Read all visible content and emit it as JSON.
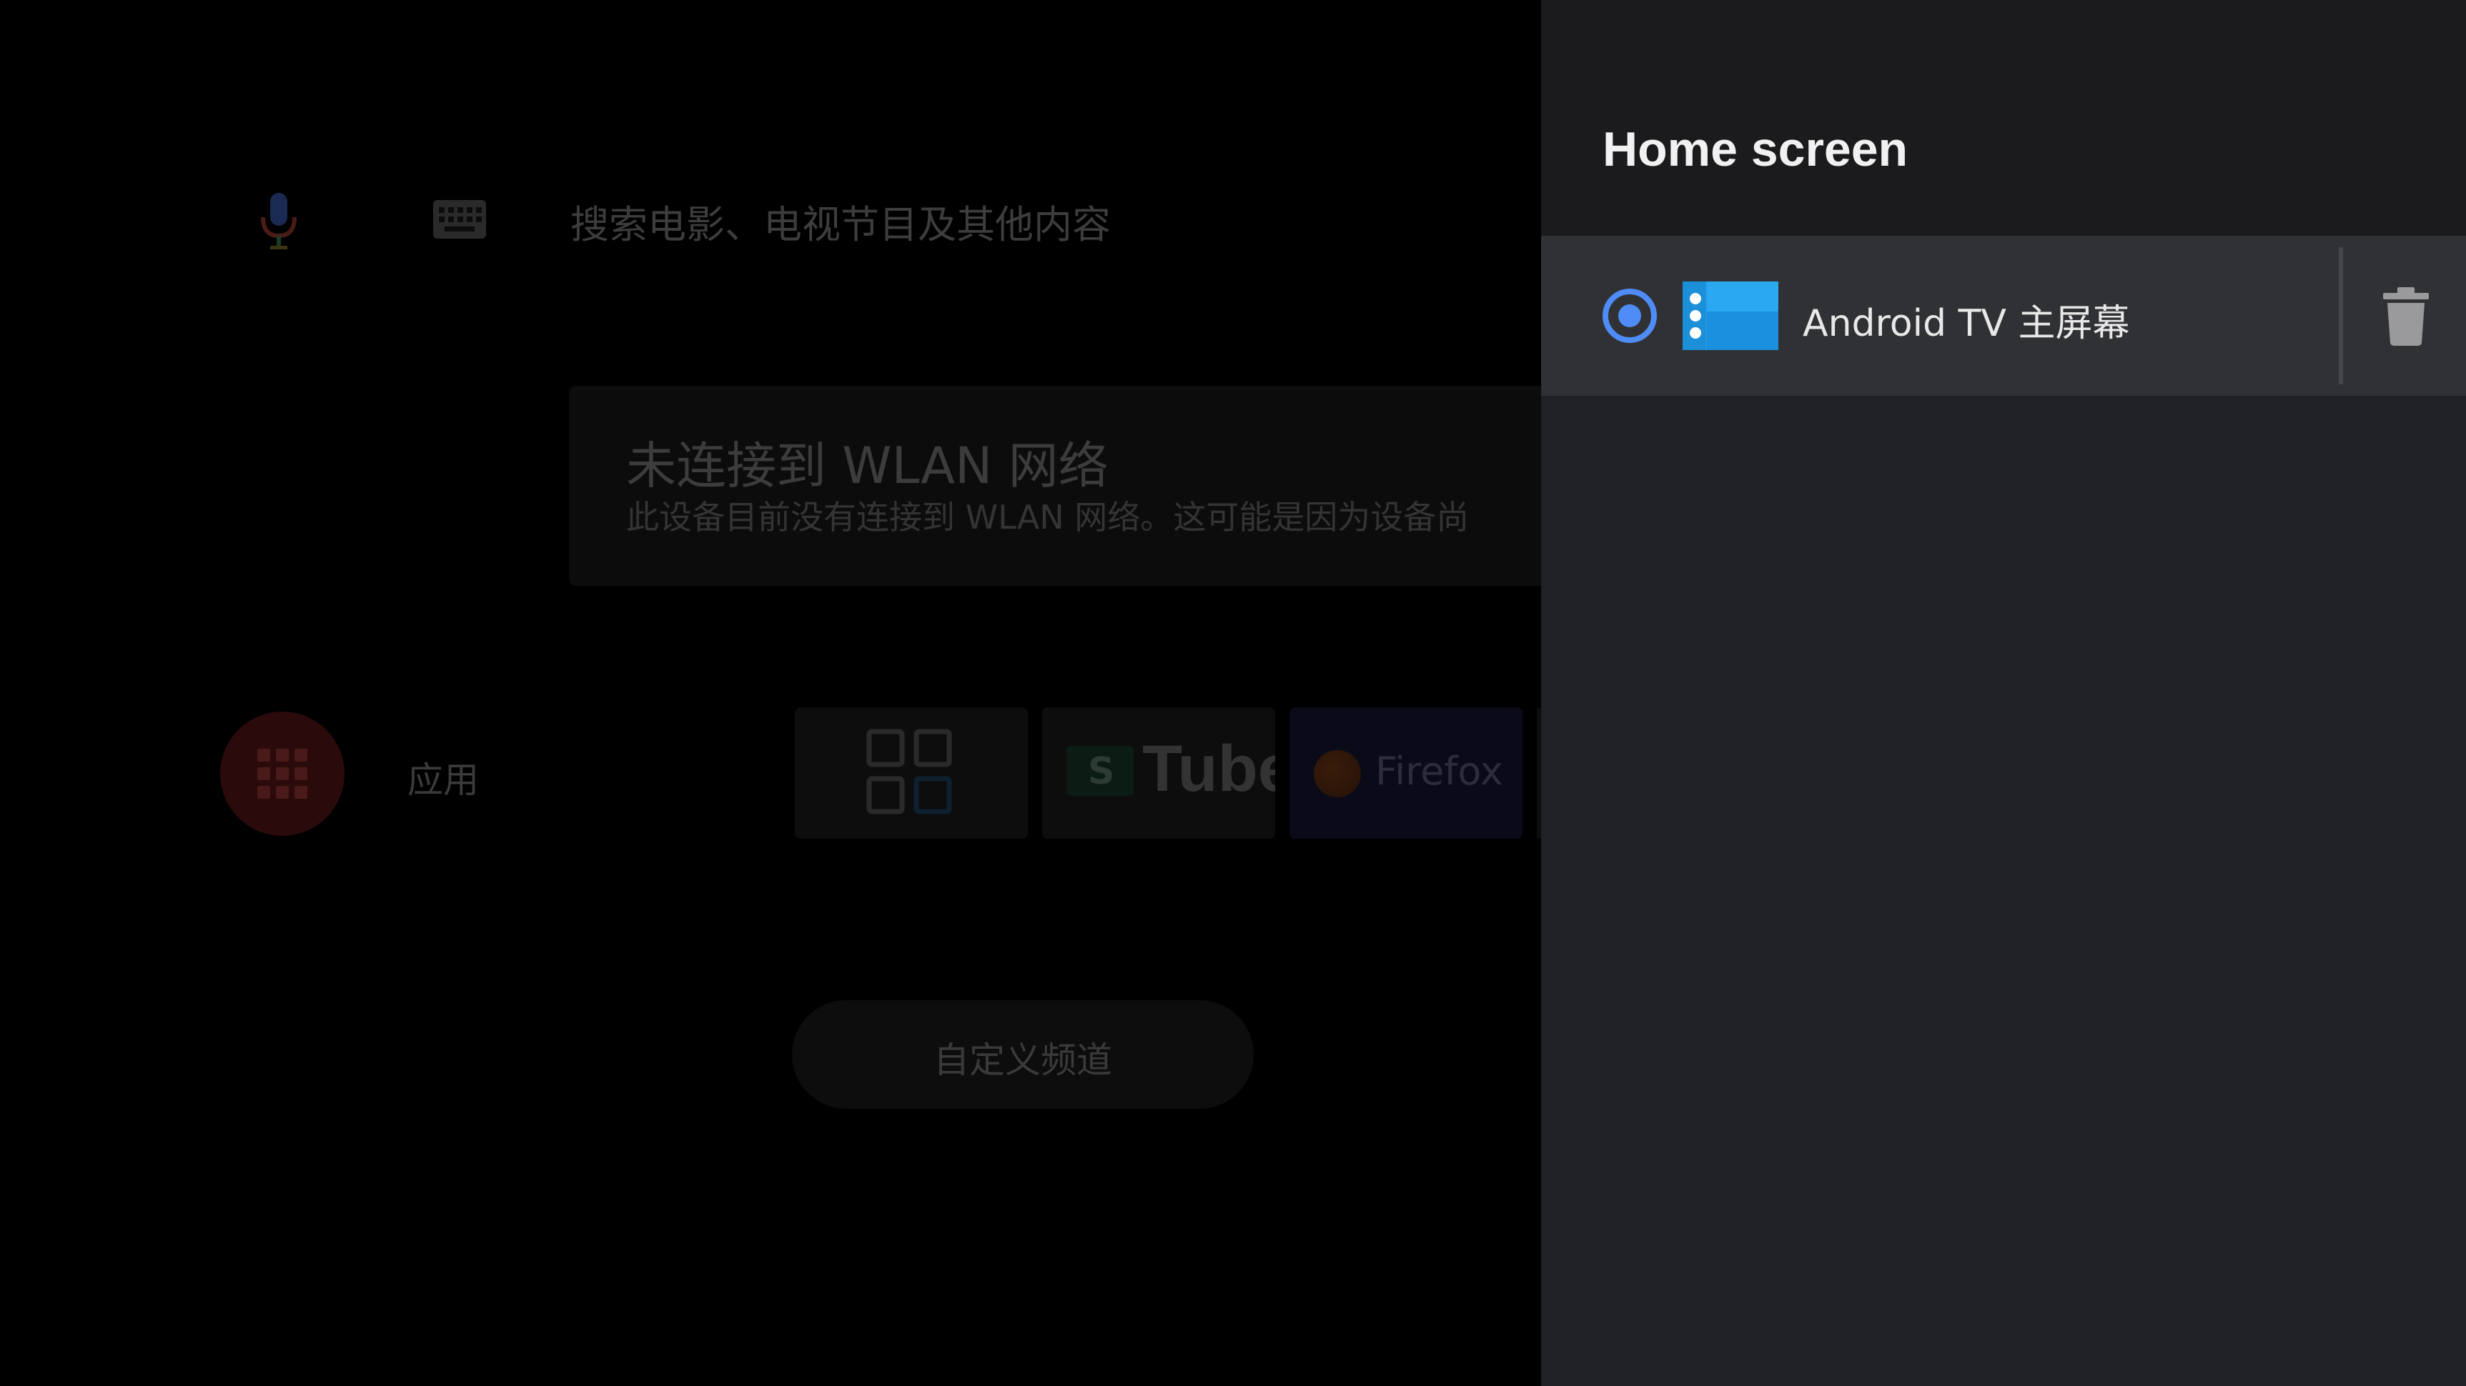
{
  "search": {
    "placeholder_text": "搜索电影、电视节目及其他内容",
    "mic_icon": "microphone-icon",
    "keyboard_icon": "keyboard-icon"
  },
  "notification": {
    "title": "未连接到 WLAN 网络",
    "description": "此设备目前没有连接到 WLAN 网络。这可能是因为设备尚"
  },
  "apps_row": {
    "label": "应用",
    "icon": "apps-grid-icon",
    "tiles": [
      {
        "name": "app-grid-tile",
        "icon": "grid-squares-icon"
      },
      {
        "name": "youtube-tile",
        "text": "Tube",
        "badge": "S"
      },
      {
        "name": "firefox-tile",
        "text": "Firefox"
      }
    ]
  },
  "customize_channels": {
    "label": "自定义频道"
  },
  "panel": {
    "title": "Home screen",
    "items": [
      {
        "label": "Android TV 主屏幕",
        "selected": true,
        "icon": "android-tv-home-icon",
        "delete_icon": "trash-icon"
      }
    ]
  },
  "colors": {
    "panel_bg": "#202124",
    "panel_header_bg": "#1b1b1d",
    "selected_row_bg": "#303134",
    "radio_accent": "#4f8cf7",
    "app_icon_blue": "#1e9be8"
  }
}
